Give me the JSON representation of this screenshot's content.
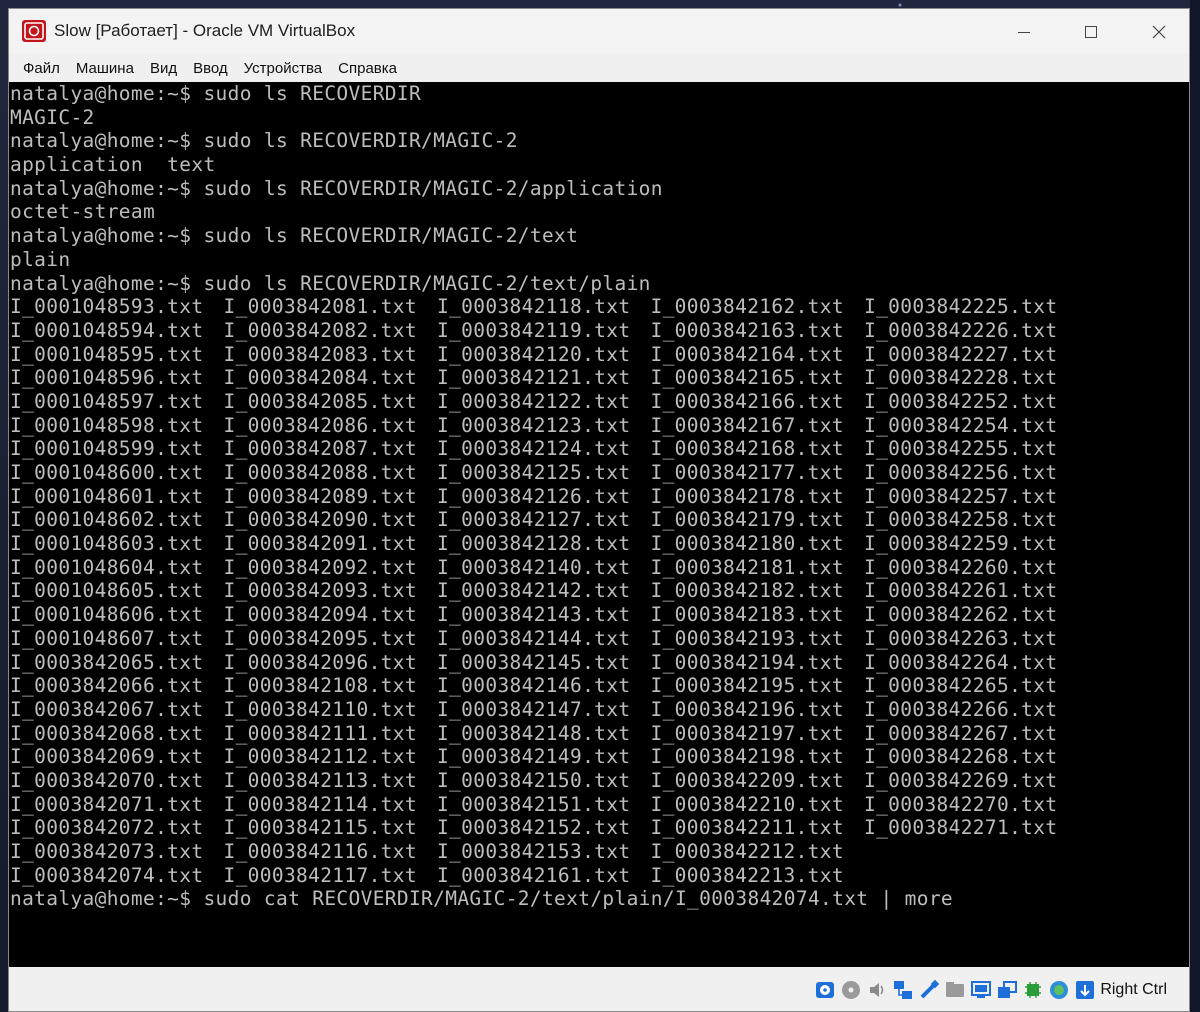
{
  "window": {
    "title": "Slow [Работает] - Oracle VM VirtualBox",
    "icons": {
      "app": "virtualbox-icon",
      "minimize": "minimize-icon",
      "maximize": "maximize-icon",
      "close": "close-icon"
    }
  },
  "menu": {
    "items": [
      "Файл",
      "Машина",
      "Вид",
      "Ввод",
      "Устройства",
      "Справка"
    ]
  },
  "terminal": {
    "lines_before": [
      "natalya@home:~$ sudo ls RECOVERDIR",
      "MAGIC-2",
      "natalya@home:~$ sudo ls RECOVERDIR/MAGIC-2",
      "application  text",
      "natalya@home:~$ sudo ls RECOVERDIR/MAGIC-2/application",
      "octet-stream",
      "natalya@home:~$ sudo ls RECOVERDIR/MAGIC-2/text",
      "plain",
      "natalya@home:~$ sudo ls RECOVERDIR/MAGIC-2/text/plain"
    ],
    "file_rows": [
      [
        "I_0001048593.txt",
        "I_0003842081.txt",
        "I_0003842118.txt",
        "I_0003842162.txt",
        "I_0003842225.txt"
      ],
      [
        "I_0001048594.txt",
        "I_0003842082.txt",
        "I_0003842119.txt",
        "I_0003842163.txt",
        "I_0003842226.txt"
      ],
      [
        "I_0001048595.txt",
        "I_0003842083.txt",
        "I_0003842120.txt",
        "I_0003842164.txt",
        "I_0003842227.txt"
      ],
      [
        "I_0001048596.txt",
        "I_0003842084.txt",
        "I_0003842121.txt",
        "I_0003842165.txt",
        "I_0003842228.txt"
      ],
      [
        "I_0001048597.txt",
        "I_0003842085.txt",
        "I_0003842122.txt",
        "I_0003842166.txt",
        "I_0003842252.txt"
      ],
      [
        "I_0001048598.txt",
        "I_0003842086.txt",
        "I_0003842123.txt",
        "I_0003842167.txt",
        "I_0003842254.txt"
      ],
      [
        "I_0001048599.txt",
        "I_0003842087.txt",
        "I_0003842124.txt",
        "I_0003842168.txt",
        "I_0003842255.txt"
      ],
      [
        "I_0001048600.txt",
        "I_0003842088.txt",
        "I_0003842125.txt",
        "I_0003842177.txt",
        "I_0003842256.txt"
      ],
      [
        "I_0001048601.txt",
        "I_0003842089.txt",
        "I_0003842126.txt",
        "I_0003842178.txt",
        "I_0003842257.txt"
      ],
      [
        "I_0001048602.txt",
        "I_0003842090.txt",
        "I_0003842127.txt",
        "I_0003842179.txt",
        "I_0003842258.txt"
      ],
      [
        "I_0001048603.txt",
        "I_0003842091.txt",
        "I_0003842128.txt",
        "I_0003842180.txt",
        "I_0003842259.txt"
      ],
      [
        "I_0001048604.txt",
        "I_0003842092.txt",
        "I_0003842140.txt",
        "I_0003842181.txt",
        "I_0003842260.txt"
      ],
      [
        "I_0001048605.txt",
        "I_0003842093.txt",
        "I_0003842142.txt",
        "I_0003842182.txt",
        "I_0003842261.txt"
      ],
      [
        "I_0001048606.txt",
        "I_0003842094.txt",
        "I_0003842143.txt",
        "I_0003842183.txt",
        "I_0003842262.txt"
      ],
      [
        "I_0001048607.txt",
        "I_0003842095.txt",
        "I_0003842144.txt",
        "I_0003842193.txt",
        "I_0003842263.txt"
      ],
      [
        "I_0003842065.txt",
        "I_0003842096.txt",
        "I_0003842145.txt",
        "I_0003842194.txt",
        "I_0003842264.txt"
      ],
      [
        "I_0003842066.txt",
        "I_0003842108.txt",
        "I_0003842146.txt",
        "I_0003842195.txt",
        "I_0003842265.txt"
      ],
      [
        "I_0003842067.txt",
        "I_0003842110.txt",
        "I_0003842147.txt",
        "I_0003842196.txt",
        "I_0003842266.txt"
      ],
      [
        "I_0003842068.txt",
        "I_0003842111.txt",
        "I_0003842148.txt",
        "I_0003842197.txt",
        "I_0003842267.txt"
      ],
      [
        "I_0003842069.txt",
        "I_0003842112.txt",
        "I_0003842149.txt",
        "I_0003842198.txt",
        "I_0003842268.txt"
      ],
      [
        "I_0003842070.txt",
        "I_0003842113.txt",
        "I_0003842150.txt",
        "I_0003842209.txt",
        "I_0003842269.txt"
      ],
      [
        "I_0003842071.txt",
        "I_0003842114.txt",
        "I_0003842151.txt",
        "I_0003842210.txt",
        "I_0003842270.txt"
      ],
      [
        "I_0003842072.txt",
        "I_0003842115.txt",
        "I_0003842152.txt",
        "I_0003842211.txt",
        "I_0003842271.txt"
      ],
      [
        "I_0003842073.txt",
        "I_0003842116.txt",
        "I_0003842153.txt",
        "I_0003842212.txt",
        ""
      ],
      [
        "I_0003842074.txt",
        "I_0003842117.txt",
        "I_0003842161.txt",
        "I_0003842213.txt",
        ""
      ]
    ],
    "last_command": "natalya@home:~$ sudo cat RECOVERDIR/MAGIC-2/text/plain/I_0003842074.txt | more"
  },
  "statusbar": {
    "icons": [
      "hard-disk-icon",
      "optical-drive-icon",
      "audio-icon",
      "network-icon",
      "usb-icon",
      "shared-folders-icon",
      "display-icon",
      "video-capture-icon",
      "cpu-icon",
      "mouse-integration-icon",
      "keyboard-capture-icon"
    ],
    "host_key": "Right Ctrl"
  },
  "colors": {
    "console_bg": "#000000",
    "console_fg": "#bdbdbd",
    "chrome_bg": "#f0f0f0"
  }
}
